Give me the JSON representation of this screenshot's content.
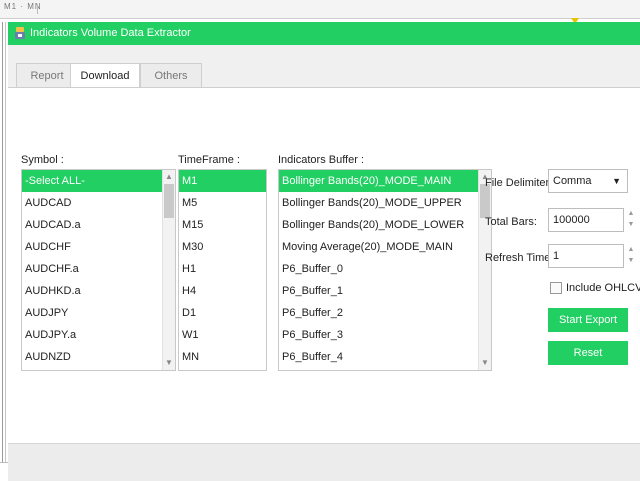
{
  "background": {
    "timeframes_label": "M1 · MN"
  },
  "window": {
    "title": "Indicators Volume Data Extractor",
    "accent_color": "#21cf62"
  },
  "tabs": [
    {
      "label": "Report",
      "active": false
    },
    {
      "label": "Download",
      "active": true
    },
    {
      "label": "Others",
      "active": false
    }
  ],
  "symbol": {
    "label": "Symbol :",
    "items": [
      "-Select ALL-",
      "AUDCAD",
      "AUDCAD.a",
      "AUDCHF",
      "AUDCHF.a",
      "AUDHKD.a",
      "AUDJPY",
      "AUDJPY.a",
      "AUDNZD"
    ],
    "selected_index": 0
  },
  "timeframe": {
    "label": "TimeFrame :",
    "items": [
      "M1",
      "M5",
      "M15",
      "M30",
      "H1",
      "H4",
      "D1",
      "W1",
      "MN"
    ],
    "selected_index": 0
  },
  "buffers": {
    "label": "Indicators Buffer :",
    "items": [
      "Bollinger Bands(20)_MODE_MAIN",
      "Bollinger Bands(20)_MODE_UPPER",
      "Bollinger Bands(20)_MODE_LOWER",
      "Moving Average(20)_MODE_MAIN",
      "P6_Buffer_0",
      "P6_Buffer_1",
      "P6_Buffer_2",
      "P6_Buffer_3",
      "P6_Buffer_4"
    ],
    "selected_index": 0
  },
  "settings": {
    "delimiter_label": "File Delimiter:",
    "delimiter_value": "Comma",
    "total_bars_label": "Total Bars:",
    "total_bars_value": "100000",
    "refresh_label": "Refresh Time:",
    "refresh_value": "1",
    "include_ohlcv_label": "Include OHLCV",
    "include_ohlcv_checked": false
  },
  "buttons": {
    "start_export": "Start Export",
    "reset": "Reset"
  }
}
